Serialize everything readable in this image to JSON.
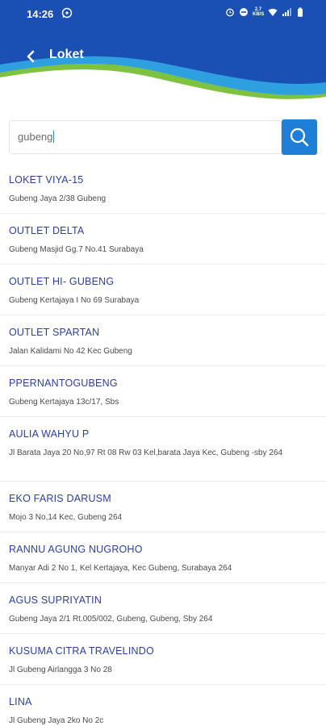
{
  "status_bar": {
    "time": "14:26",
    "net_speed": "2.7\nKB/S"
  },
  "app_bar": {
    "title": "Loket"
  },
  "search": {
    "value": "gubeng"
  },
  "colors": {
    "header_blue": "#1a4fb4",
    "header_green": "#7ec242",
    "header_cyan": "#2ea0e0",
    "search_button": "#1f7fd6",
    "item_name": "#2b3f9e"
  },
  "results": [
    {
      "name": "LOKET VIYA-15",
      "address": "Gubeng Jaya 2/38 Gubeng"
    },
    {
      "name": "OUTLET DELTA",
      "address": "Gubeng Masjid Gg.7 No.41 Surabaya"
    },
    {
      "name": "OUTLET HI- GUBENG",
      "address": "Gubeng Kertajaya I No 69 Surabaya"
    },
    {
      "name": "OUTLET SPARTAN",
      "address": "Jalan Kalidami No 42 Kec Gubeng"
    },
    {
      "name": "PPERNANTOGUBENG",
      "address": "Gubeng Kertajaya 13c/17, Sbs"
    },
    {
      "name": "AULIA WAHYU P",
      "address": "Jl Barata Jaya 20 No,97 Rt 08 Rw 03 Kel,barata Jaya Kec, Gubeng -sby 264"
    },
    {
      "name": "EKO FARIS DARUSM",
      "address": "Mojo 3 No,14 Kec, Gubeng 264"
    },
    {
      "name": "RANNU AGUNG NUGROHO",
      "address": "Manyar Adi 2 No 1, Kel Kertajaya, Kec Gubeng, Surabaya 264"
    },
    {
      "name": "AGUS SUPRIYATIN",
      "address": "Gubeng Jaya 2/1 Rt.005/002, Gubeng, Gubeng, Sby 264"
    },
    {
      "name": "KUSUMA CITRA TRAVELINDO",
      "address": "Jl Gubeng Airlangga 3 No 28"
    },
    {
      "name": "LINA",
      "address": "Jl Gubeng Jaya 2ko No 2c"
    }
  ]
}
